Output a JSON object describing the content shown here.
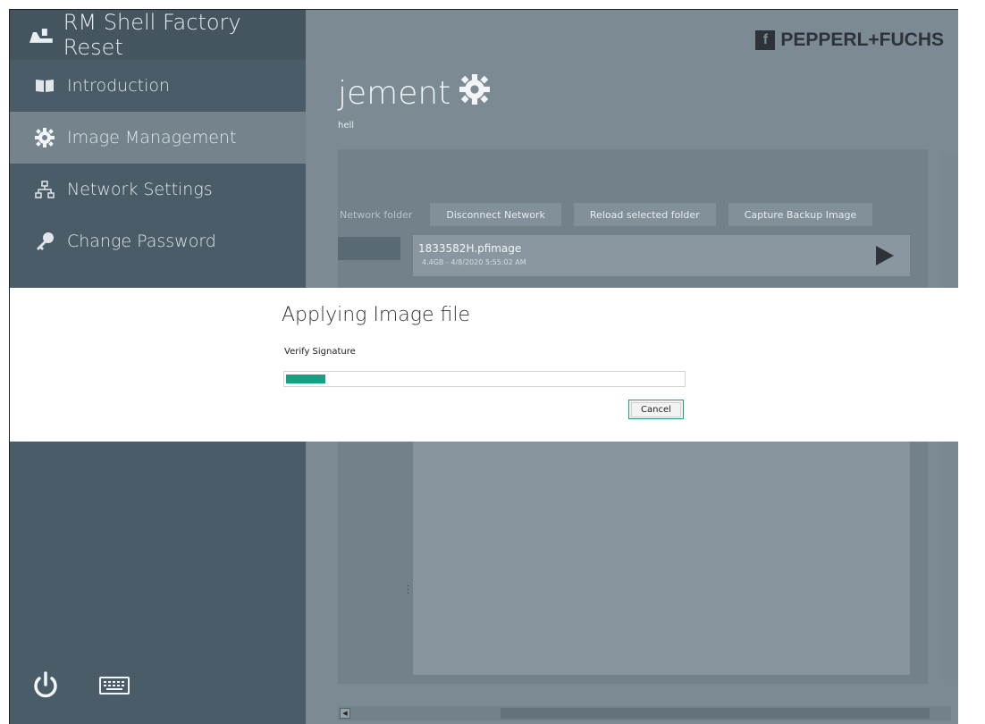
{
  "sidebar": {
    "title": "RM Shell Factory Reset",
    "items": [
      {
        "label": "Introduction",
        "icon": "book-icon"
      },
      {
        "label": "Image Management",
        "icon": "gear-icon"
      },
      {
        "label": "Network Settings",
        "icon": "network-icon"
      },
      {
        "label": "Change Password",
        "icon": "key-icon"
      }
    ],
    "active_index": 1
  },
  "brand": {
    "name": "PEPPERL+FUCHS",
    "mark": "f"
  },
  "main": {
    "title_fragment": "jement",
    "subtitle_fragment": "hell",
    "toolbar": {
      "partial_button": "Network folder",
      "buttons": [
        "Disconnect Network",
        "Reload selected folder",
        "Capture Backup Image"
      ]
    },
    "file": {
      "name": "1833582H.pfimage",
      "meta": "4.4GB - 4/8/2020 5:55:02 AM"
    }
  },
  "dialog": {
    "title": "Applying Image file",
    "status": "Verify Signature",
    "progress": 0.1,
    "cancel_label": "Cancel"
  },
  "colors": {
    "accent": "#16a082",
    "sidebar": "#4a5c68",
    "sidebar_active": "#75838c",
    "overlay_main": "#7c8a94",
    "dialog_bg": "#ffffff"
  }
}
